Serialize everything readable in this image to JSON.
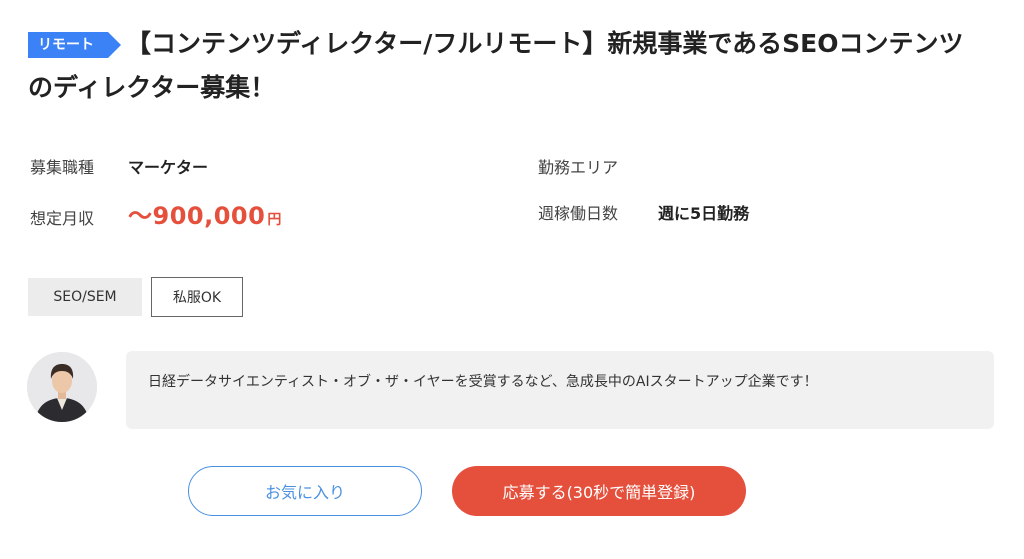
{
  "job": {
    "badge": "リモート",
    "title": "【コンテンツディレクター/フルリモート】新規事業であるSEOコンテンツのディレクター募集！"
  },
  "details": {
    "position_label": "募集職種",
    "position_value": "マーケター",
    "area_label": "勤務エリア",
    "area_value": "",
    "salary_label": "想定月収",
    "salary_value": "〜900,000",
    "salary_unit": "円",
    "days_label": "週稼働日数",
    "days_value": "週に5日勤務"
  },
  "tags": [
    "SEO/SEM",
    "私服OK"
  ],
  "company": {
    "message": "日経データサイエンティスト・オブ・ザ・イヤーを受賞するなど、急成長中のAIスタートアップ企業です！"
  },
  "buttons": {
    "favorite_label": "お気に入り",
    "apply_label": "応募する(30秒で簡単登録)"
  },
  "colors": {
    "accent_blue": "#3b82f6",
    "accent_red": "#e4503c",
    "outline_blue": "#4a90e2"
  }
}
